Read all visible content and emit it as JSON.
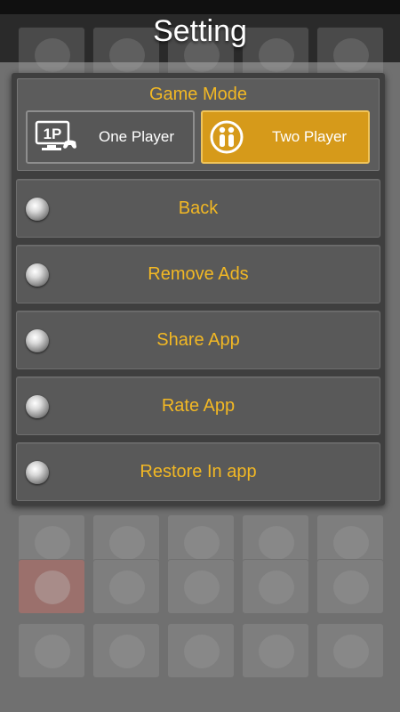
{
  "header": {
    "title": "Setting"
  },
  "game_mode": {
    "title": "Game Mode",
    "options": [
      {
        "label": "One Player",
        "icon": "one-player-icon",
        "badge": "1P",
        "selected": false
      },
      {
        "label": "Two Player",
        "icon": "two-player-icon",
        "selected": true
      }
    ]
  },
  "menu": {
    "items": [
      {
        "label": "Back"
      },
      {
        "label": "Remove Ads"
      },
      {
        "label": "Share App"
      },
      {
        "label": "Rate App"
      },
      {
        "label": "Restore In app"
      }
    ]
  },
  "colors": {
    "accent_text": "#f2b824",
    "selected_mode": "#d69a1a",
    "panel": "#3f3f3f",
    "row": "#595959"
  }
}
